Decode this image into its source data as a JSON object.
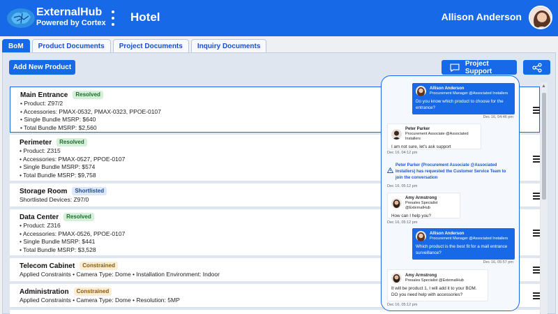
{
  "header": {
    "brand": "ExternalHub",
    "subtitle": "Powered by Cortex",
    "title": "Hotel",
    "user_name": "Allison Anderson"
  },
  "tabs": [
    {
      "label": "BoM",
      "active": true
    },
    {
      "label": "Product Documents"
    },
    {
      "label": "Project Documents"
    },
    {
      "label": "Inquiry Documents"
    }
  ],
  "toolbar": {
    "add_product": "Add New Product",
    "project_support": "Project Support"
  },
  "items": [
    {
      "title": "Main Entrance",
      "status": "Resolved",
      "lines": [
        "• Product: Z97/2",
        "• Accessories: PMAX-0532, PMAX-0323, PPOE-0107",
        "• Single Bundle MSRP: $640",
        "• Total Bundle MSRP: $2,560"
      ]
    },
    {
      "title": "Perimeter",
      "status": "Resolved",
      "lines": [
        "• Product: Z315",
        "• Accessories: PMAX-0527, PPOE-0107",
        "• Single Bundle MSRP: $574",
        "• Total Bundle MSRP: $9,758"
      ]
    },
    {
      "title": "Storage Room",
      "status": "Shortlisted",
      "lines": [
        "Shortlisted Devices: Z97/0"
      ]
    },
    {
      "title": "Data Center",
      "status": "Resolved",
      "lines": [
        "• Product: Z316",
        "• Accessories: PMAX-0526, PPOE-0107",
        "• Single Bundle MSRP: $441",
        "• Total Bundle MSRP: $3,528"
      ]
    },
    {
      "title": "Telecom Cabinet",
      "status": "Constrained",
      "lines": [
        "Applied Constraints  • Camera Type: Dome  • Installation Environment: Indoor"
      ]
    },
    {
      "title": "Administration",
      "status": "Constrained",
      "lines": [
        "Applied Constraints  • Camera Type: Dome  • Resolution: 5MP"
      ]
    }
  ],
  "chat": {
    "messages": [
      {
        "name": "Allison Anderson",
        "role": "Procurement Manager @Associated Installers",
        "text": "Do you know which product to choose for the entrance?",
        "time": "Dec 16, 04:46 pm"
      },
      {
        "name": "Peter Parker",
        "role": "Procurement Associate @Associated Installers",
        "text": "I am not sure, let's ask support",
        "time": "Dec 16, 04:12 pm"
      },
      {
        "system": "Peter Parker (Procurement Associate @Associated Installers) has requested the Customer Service Team to join the conversation",
        "time": "Dec 16, 05:12 pm"
      },
      {
        "name": "Amy Armstrong",
        "role": "Presales Specialist @ExternalHub",
        "text": "How can I help you?",
        "time": "Dec 16, 05:12 pm"
      },
      {
        "name": "Allison Anderson",
        "role": "Procurement Manager @Associated Installers",
        "text": "Which product is the best fit for a mall entrance surveillance?",
        "time": "Dec 16, 05:57 pm"
      },
      {
        "name": "Amy Armstrong",
        "role": "Presales Specialist @ExternalHub",
        "text": "It will be product 1, I will add it to your BOM. DO you need help with accessories?",
        "time": "Dec 16, 05:12 pm"
      }
    ]
  },
  "colors": {
    "primary": "#1769e8",
    "resolved": "#d5f0d9",
    "shortlisted": "#dce8fb",
    "constrained": "#fbecd2"
  }
}
